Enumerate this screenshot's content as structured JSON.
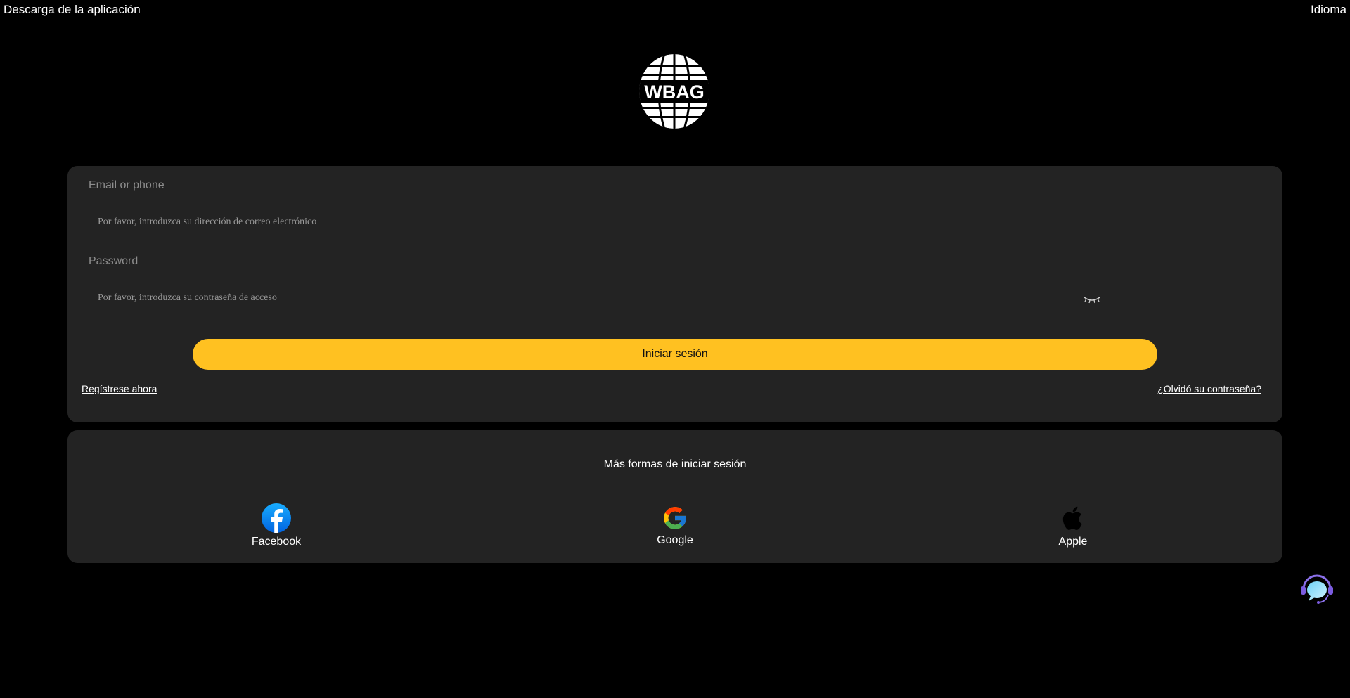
{
  "topbar": {
    "app_download": "Descarga de la aplicación",
    "language": "Idioma"
  },
  "logo": {
    "text": "WBAG",
    "icon": "globe-logo-icon"
  },
  "login": {
    "email_label": "Email or phone",
    "email_placeholder": "Por favor, introduzca su dirección de correo electrónico",
    "password_label": "Password",
    "password_placeholder": "Por favor, introduzca su contraseña de acceso",
    "password_toggle_icon": "eye-closed-icon",
    "submit_label": "Iniciar sesión",
    "register_link": "Regístrese ahora",
    "forgot_link": "¿Olvidó su contraseña?"
  },
  "social": {
    "title": "Más formas de iniciar sesión",
    "items": [
      {
        "label": "Facebook",
        "icon": "facebook-icon"
      },
      {
        "label": "Google",
        "icon": "google-icon"
      },
      {
        "label": "Apple",
        "icon": "apple-icon"
      }
    ]
  },
  "support": {
    "icon": "support-chat-icon"
  },
  "colors": {
    "background": "#000000",
    "card": "#232323",
    "accent": "#ffc121",
    "label": "#8e8e8e",
    "facebook": "#1877f2"
  }
}
